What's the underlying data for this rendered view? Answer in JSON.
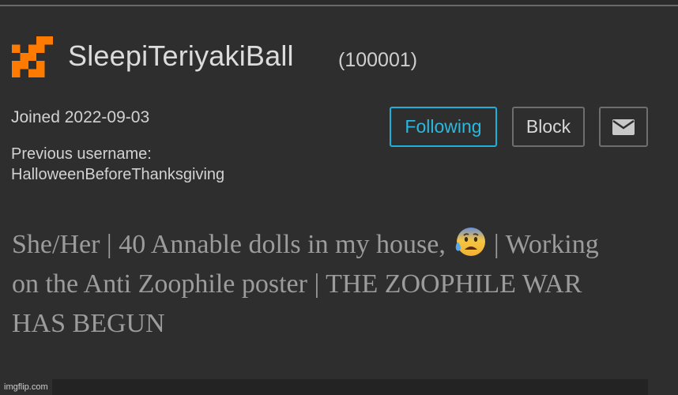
{
  "profile": {
    "username": "SleepiTeriyakiBall",
    "user_id": "(100001)",
    "joined": "Joined 2022-09-03",
    "previous_username_label": "Previous username:",
    "previous_username": "HalloweenBeforeThanksgiving",
    "bio_part1": "She/Her | 40 Annable dolls in my house, ",
    "bio_part2": " | Working on the Anti Zoophile poster | THE ZOOPHILE WAR HAS BEGUN"
  },
  "actions": {
    "following_label": "Following",
    "block_label": "Block",
    "message_icon": "mail-icon"
  },
  "watermark": "imgflip.com",
  "colors": {
    "background": "#2e2e2e",
    "accent": "#2bb8e0",
    "avatar": "#ff7a00"
  }
}
